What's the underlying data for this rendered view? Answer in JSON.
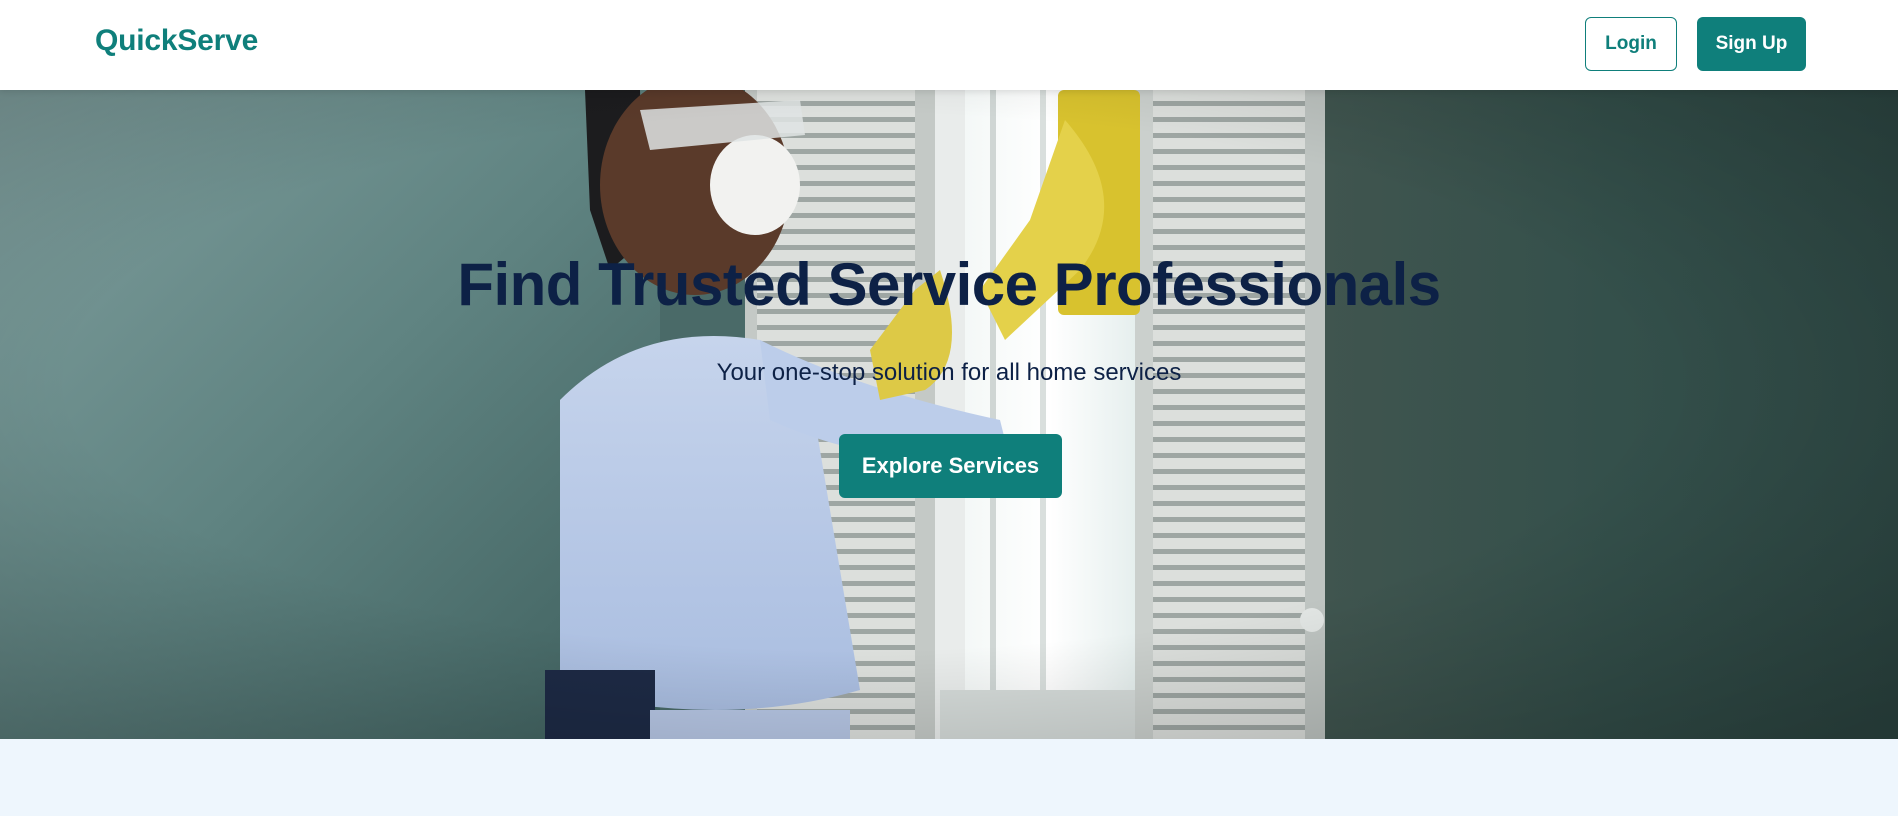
{
  "header": {
    "brand": "QuickServe",
    "login_label": "Login",
    "signup_label": "Sign Up"
  },
  "hero": {
    "title": "Find Trusted Service Professionals",
    "subtitle": "Your one-stop solution for all home services",
    "cta_label": "Explore Services",
    "image_alt": "Person wearing a mask, goggles and yellow gloves cleaning a window"
  },
  "colors": {
    "brand": "#0f7f7b",
    "heading": "#0d2146",
    "page_background": "#eef6fd"
  }
}
